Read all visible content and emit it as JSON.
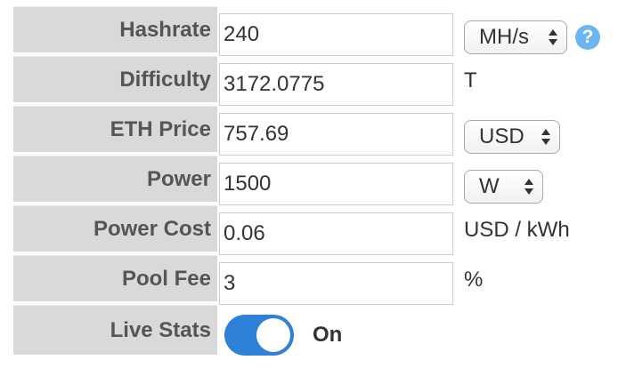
{
  "fields": {
    "hashrate": {
      "label": "Hashrate",
      "value": "240",
      "unit_select": "MH/s",
      "help_icon": "question-mark-icon",
      "help_glyph": "?"
    },
    "difficulty": {
      "label": "Difficulty",
      "value": "3172.0775",
      "unit": "T"
    },
    "eth_price": {
      "label": "ETH Price",
      "value": "757.69",
      "unit_select": "USD"
    },
    "power": {
      "label": "Power",
      "value": "1500",
      "unit_select": "W"
    },
    "power_cost": {
      "label": "Power Cost",
      "value": "0.06",
      "unit": "USD / kWh"
    },
    "pool_fee": {
      "label": "Pool Fee",
      "value": "3",
      "unit": "%"
    },
    "live_stats": {
      "label": "Live Stats",
      "state": "On"
    }
  },
  "colors": {
    "label_bg": "#d9d9d9",
    "toggle_on": "#2f80d8",
    "help_icon": "#6cb6f0"
  }
}
